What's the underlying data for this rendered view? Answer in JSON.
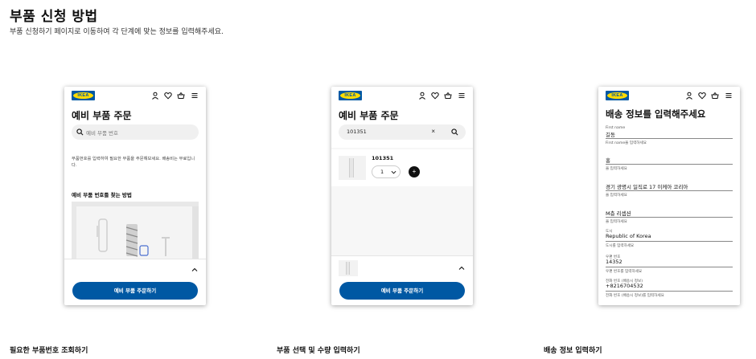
{
  "page": {
    "title": "부품 신청 방법",
    "description": "부품 신청하기 페이지로 이동하여 각 단계에 맞는 정보를 입력해주세요."
  },
  "brand": {
    "logo_text": "IKEA",
    "primary_color": "#0058a3",
    "logo_yellow": "#ffdb00"
  },
  "header_icons": [
    "user-icon",
    "heart-icon",
    "basket-icon",
    "menu-icon"
  ],
  "screen1": {
    "title": "예비 부품 주문",
    "search_placeholder": "예비 부품 번호",
    "description": "부품번호를 입력하여 필요한 부품을 주문해보세요. 배송비는 무료입니다.",
    "howto_heading": "예비 부품 번호를 찾는 방법",
    "cta_label": "예비 부품 주문하기"
  },
  "screen2": {
    "title": "예비 부품 주문",
    "search_value": "101351",
    "clear_label": "×",
    "product_number": "101351",
    "quantity": "1",
    "add_label": "+",
    "cta_label": "예비 부품 주문하기"
  },
  "screen3": {
    "title": "배송 정보를 입력해주세요",
    "fields": [
      {
        "label": "First name",
        "value": "길동",
        "help": "First name을 입력하세요"
      },
      {
        "label": "",
        "value": "홍",
        "help": "을 입력하세요"
      },
      {
        "label": "",
        "value": "경기 광명시 일직로 17 이케아 코리아",
        "help": "을 입력하세요"
      },
      {
        "label": "",
        "value": "M층 리셉션",
        "help": "을 입력하세요"
      },
      {
        "label": "도시",
        "value": "Republic of Korea",
        "help": "도시를 입력하세요"
      },
      {
        "label": "우편 번호",
        "value": "14352",
        "help": "우편 번호를 입력하세요"
      },
      {
        "label": "전화 번호 (배송시 정보)",
        "value": "+8216704532",
        "help": "전화 번호 (배송시 정보)를 입력하세요"
      }
    ]
  },
  "steps": [
    "필요한 부품번호 조회하기",
    "부품 선택 및 수량 입력하기",
    "배송 정보 입력하기"
  ]
}
